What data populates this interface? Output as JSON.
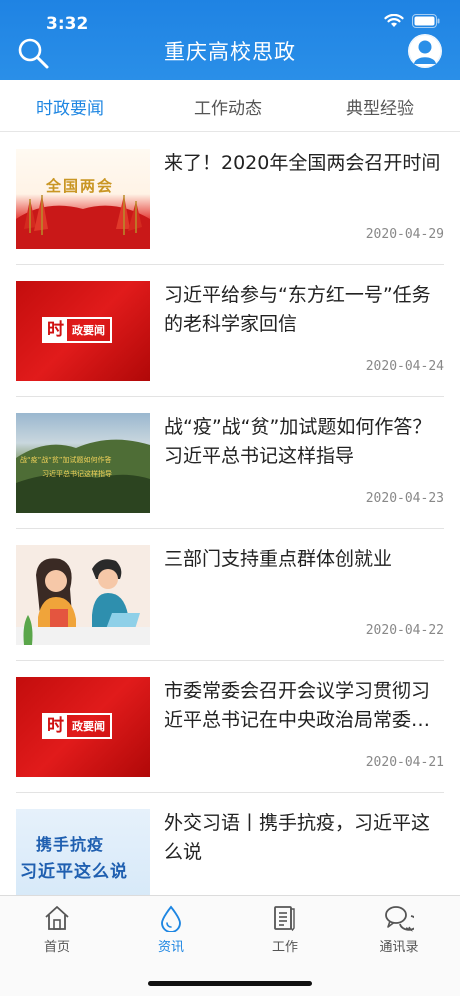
{
  "status": {
    "time": "3:32"
  },
  "header": {
    "title": "重庆高校思政"
  },
  "tabs": [
    {
      "label": "时政要闻"
    },
    {
      "label": "工作动态"
    },
    {
      "label": "典型经验"
    }
  ],
  "articles": [
    {
      "title": "来了！2020年全国两会召开时间",
      "date": "2020-04-29",
      "thumb_text": "全国两会"
    },
    {
      "title": "习近平给参与“东方红一号”任务的老科学家回信",
      "date": "2020-04-24",
      "thumb_text": "时",
      "thumb_text2": "政要闻"
    },
    {
      "title": "战“疫”战“贫”加试题如何作答？习近平总书记这样指导",
      "date": "2020-04-23",
      "thumb_text": "战“疫”战“贫”加试题如何作答",
      "thumb_text2": "习近平总书记这样指导"
    },
    {
      "title": "三部门支持重点群体创就业",
      "date": "2020-04-22"
    },
    {
      "title": "市委常委会召开会议学习贯彻习近平总书记在中央政治局常委会会议上的重要讲话精神",
      "date": "2020-04-21",
      "thumb_text": "时",
      "thumb_text2": "政要闻"
    },
    {
      "title": "外交习语丨携手抗疫，习近平这么说",
      "date": "",
      "thumb_text": "携手抗疫",
      "thumb_text2": "习近平这么说"
    }
  ],
  "nav": [
    {
      "label": "首页",
      "icon": "home-icon"
    },
    {
      "label": "资讯",
      "icon": "droplet-icon"
    },
    {
      "label": "工作",
      "icon": "document-icon"
    },
    {
      "label": "通讯录",
      "icon": "chat-icon"
    }
  ],
  "colors": {
    "primary": "#1e86e2",
    "header": "#2a8fe8",
    "thumb_red": "#d01111"
  }
}
